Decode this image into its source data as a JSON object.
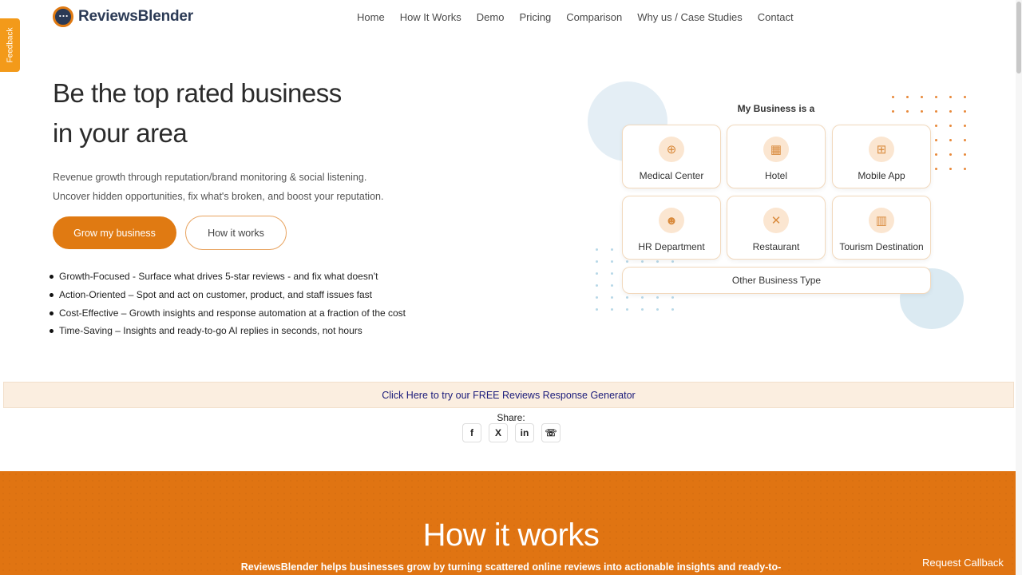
{
  "feedback": {
    "label": "Feedback"
  },
  "header": {
    "brand": "ReviewsBlender",
    "nav": [
      "Home",
      "How It Works",
      "Demo",
      "Pricing",
      "Comparison",
      "Why us / Case Studies",
      "Contact"
    ]
  },
  "hero": {
    "title_line1": "Be the top rated business",
    "title_line2": "in your area",
    "sub_line1": "Revenue growth through reputation/brand monitoring & social listening.",
    "sub_line2": "Uncover hidden opportunities, fix what's broken, and boost your reputation.",
    "primary_cta": "Grow my business",
    "secondary_cta": "How it works",
    "bullets": [
      "Growth-Focused - Surface what drives 5-star reviews - and fix what doesn’t",
      "Action-Oriented – Spot and act on customer, product, and staff issues fast",
      "Cost-Effective – Growth insights and response automation at a fraction of the cost",
      "Time-Saving – Insights and ready-to-go AI replies in seconds, not hours"
    ]
  },
  "business_selector": {
    "title": "My Business is a",
    "types": [
      {
        "label": "Medical Center",
        "icon": "medical-icon"
      },
      {
        "label": "Hotel",
        "icon": "hotel-icon"
      },
      {
        "label": "Mobile App",
        "icon": "apps-icon"
      },
      {
        "label": "HR Department",
        "icon": "people-icon"
      },
      {
        "label": "Restaurant",
        "icon": "cutlery-icon"
      },
      {
        "label": "Tourism Destination",
        "icon": "map-icon"
      }
    ],
    "other": "Other Business Type"
  },
  "promo": {
    "link": "Click Here to try our FREE Reviews Response Generator"
  },
  "share": {
    "label": "Share:",
    "buttons": [
      {
        "glyph": "f",
        "icon": "facebook-icon"
      },
      {
        "glyph": "X",
        "icon": "x-twitter-icon"
      },
      {
        "glyph": "in",
        "icon": "linkedin-icon"
      },
      {
        "glyph": "☏",
        "icon": "whatsapp-icon"
      }
    ]
  },
  "how": {
    "title": "How it works",
    "subtitle": "ReviewsBlender helps businesses grow by turning scattered online reviews into actionable insights and ready-to-"
  },
  "callback": {
    "label": "Request Callback"
  },
  "colors": {
    "accent": "#e07412",
    "brand_navy": "#2b3a55",
    "banner_bg": "#fbeee0"
  }
}
